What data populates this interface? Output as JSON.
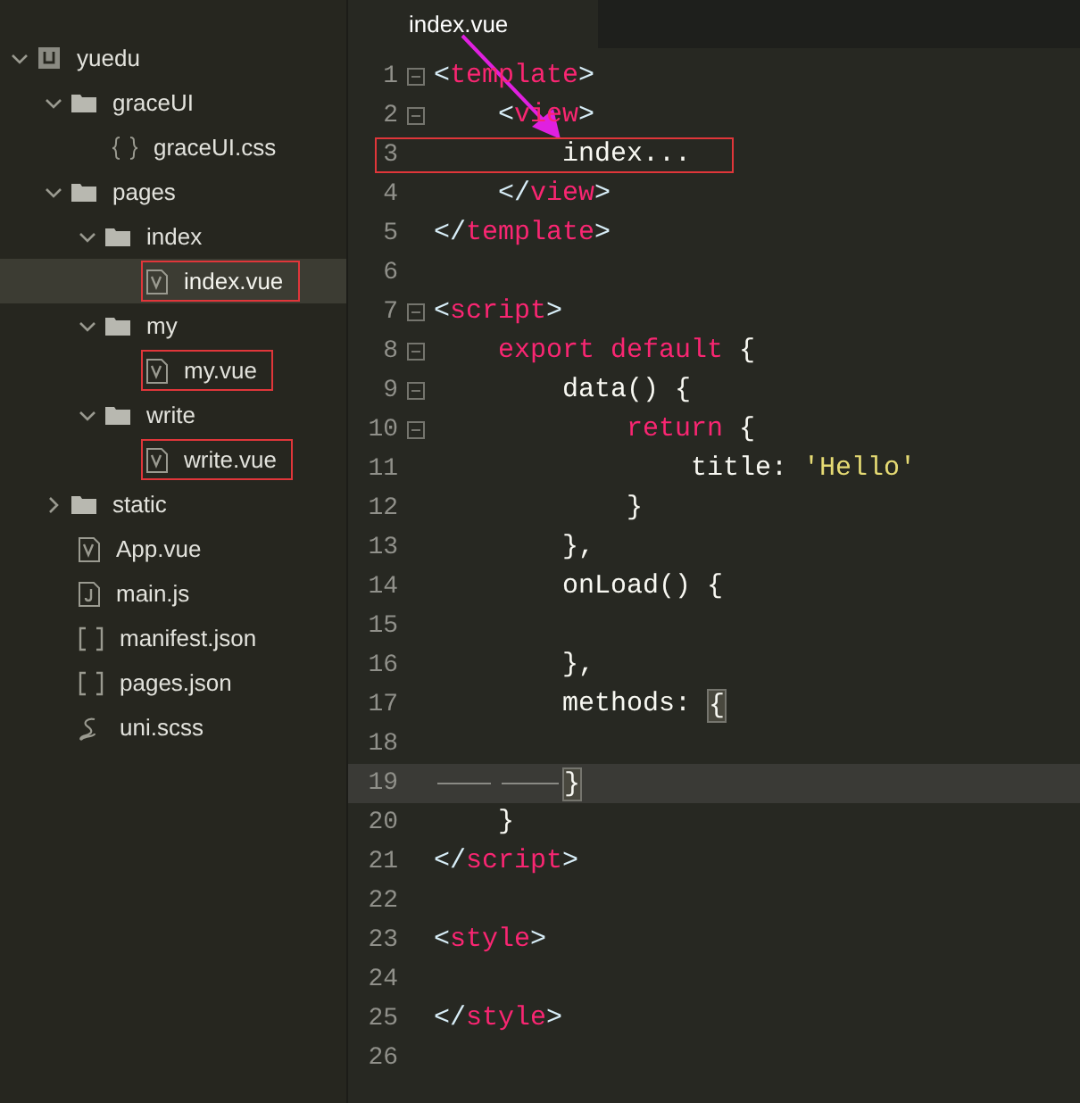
{
  "sidebar": {
    "tree": [
      {
        "label": "yuedu",
        "kind": "project",
        "expanded": true,
        "selected": false,
        "marked": false,
        "children": [
          {
            "label": "graceUI",
            "kind": "folder",
            "expanded": true,
            "selected": false,
            "marked": false,
            "children": [
              {
                "label": "graceUI.css",
                "kind": "css",
                "selected": false,
                "marked": false
              }
            ]
          },
          {
            "label": "pages",
            "kind": "folder",
            "expanded": true,
            "selected": false,
            "marked": false,
            "children": [
              {
                "label": "index",
                "kind": "folder",
                "expanded": true,
                "selected": false,
                "marked": false,
                "children": [
                  {
                    "label": "index.vue",
                    "kind": "vue",
                    "selected": true,
                    "marked": true
                  }
                ]
              },
              {
                "label": "my",
                "kind": "folder",
                "expanded": true,
                "selected": false,
                "marked": false,
                "children": [
                  {
                    "label": "my.vue",
                    "kind": "vue",
                    "selected": false,
                    "marked": true
                  }
                ]
              },
              {
                "label": "write",
                "kind": "folder",
                "expanded": true,
                "selected": false,
                "marked": false,
                "children": [
                  {
                    "label": "write.vue",
                    "kind": "vue",
                    "selected": false,
                    "marked": true
                  }
                ]
              }
            ]
          },
          {
            "label": "static",
            "kind": "folder",
            "expanded": false,
            "selected": false,
            "marked": false
          },
          {
            "label": "App.vue",
            "kind": "vue",
            "selected": false,
            "marked": false
          },
          {
            "label": "main.js",
            "kind": "js",
            "selected": false,
            "marked": false
          },
          {
            "label": "manifest.json",
            "kind": "json",
            "selected": false,
            "marked": false
          },
          {
            "label": "pages.json",
            "kind": "json",
            "selected": false,
            "marked": false
          },
          {
            "label": "uni.scss",
            "kind": "scss",
            "selected": false,
            "marked": false
          }
        ]
      }
    ]
  },
  "editor": {
    "tabs": [
      {
        "label": "index.vue",
        "selected": true
      }
    ],
    "lines": [
      {
        "number": "1",
        "fold": true,
        "tokens": [
          {
            "kind": "punct",
            "text": "<"
          },
          {
            "kind": "tag",
            "text": "template"
          },
          {
            "kind": "punct",
            "text": ">"
          }
        ]
      },
      {
        "number": "2",
        "fold": true,
        "tokens": [
          {
            "kind": "punct",
            "text": "    <"
          },
          {
            "kind": "tag",
            "text": "view"
          },
          {
            "kind": "punct",
            "text": ">"
          }
        ]
      },
      {
        "number": "3",
        "fold": false,
        "marked": true,
        "tokens": [
          {
            "kind": "plain",
            "text": "        index..."
          }
        ]
      },
      {
        "number": "4",
        "fold": false,
        "tokens": [
          {
            "kind": "punct",
            "text": "    </"
          },
          {
            "kind": "tag",
            "text": "view"
          },
          {
            "kind": "punct",
            "text": ">"
          }
        ]
      },
      {
        "number": "5",
        "fold": false,
        "tokens": [
          {
            "kind": "punct",
            "text": "</"
          },
          {
            "kind": "tag",
            "text": "template"
          },
          {
            "kind": "punct",
            "text": ">"
          }
        ]
      },
      {
        "number": "6",
        "fold": false
      },
      {
        "number": "7",
        "fold": true,
        "tokens": [
          {
            "kind": "punct",
            "text": "<"
          },
          {
            "kind": "tag",
            "text": "script"
          },
          {
            "kind": "punct",
            "text": ">"
          }
        ]
      },
      {
        "number": "8",
        "fold": true,
        "tokens": [
          {
            "kind": "keyword",
            "text": "    export default"
          },
          {
            "kind": "plain",
            "text": " {"
          }
        ]
      },
      {
        "number": "9",
        "fold": true,
        "tokens": [
          {
            "kind": "plain",
            "text": "        data() {"
          }
        ]
      },
      {
        "number": "10",
        "fold": true,
        "tokens": [
          {
            "kind": "keyword",
            "text": "            return"
          },
          {
            "kind": "plain",
            "text": " {"
          }
        ]
      },
      {
        "number": "11",
        "fold": false,
        "tokens": [
          {
            "kind": "plain",
            "text": "                title: "
          },
          {
            "kind": "string",
            "text": "'Hello'"
          }
        ]
      },
      {
        "number": "12",
        "fold": false,
        "tokens": [
          {
            "kind": "plain",
            "text": "            }"
          }
        ]
      },
      {
        "number": "13",
        "fold": false,
        "tokens": [
          {
            "kind": "plain",
            "text": "        },"
          }
        ]
      },
      {
        "number": "14",
        "fold": false,
        "tokens": [
          {
            "kind": "plain",
            "text": "        onLoad() {"
          }
        ]
      },
      {
        "number": "15",
        "fold": false
      },
      {
        "number": "16",
        "fold": false,
        "tokens": [
          {
            "kind": "plain",
            "text": "        },"
          }
        ]
      },
      {
        "number": "17",
        "fold": false,
        "tokens": [
          {
            "kind": "plain",
            "text": "        methods: "
          },
          {
            "kind": "match",
            "text": "{"
          }
        ]
      },
      {
        "number": "18",
        "fold": false
      },
      {
        "number": "19",
        "fold": false,
        "current": true,
        "whitespace_markers": true,
        "tokens": [
          {
            "kind": "match",
            "text": "}"
          }
        ]
      },
      {
        "number": "20",
        "fold": false,
        "tokens": [
          {
            "kind": "plain",
            "text": "    }"
          }
        ]
      },
      {
        "number": "21",
        "fold": false,
        "tokens": [
          {
            "kind": "punct",
            "text": "</"
          },
          {
            "kind": "tag",
            "text": "script"
          },
          {
            "kind": "punct",
            "text": ">"
          }
        ]
      },
      {
        "number": "22",
        "fold": false
      },
      {
        "number": "23",
        "fold": false,
        "tokens": [
          {
            "kind": "punct",
            "text": "<"
          },
          {
            "kind": "tag",
            "text": "style"
          },
          {
            "kind": "punct",
            "text": ">"
          }
        ]
      },
      {
        "number": "24",
        "fold": false
      },
      {
        "number": "25",
        "fold": false,
        "tokens": [
          {
            "kind": "punct",
            "text": "</"
          },
          {
            "kind": "tag",
            "text": "style"
          },
          {
            "kind": "punct",
            "text": ">"
          }
        ]
      },
      {
        "number": "26",
        "fold": false
      }
    ]
  }
}
